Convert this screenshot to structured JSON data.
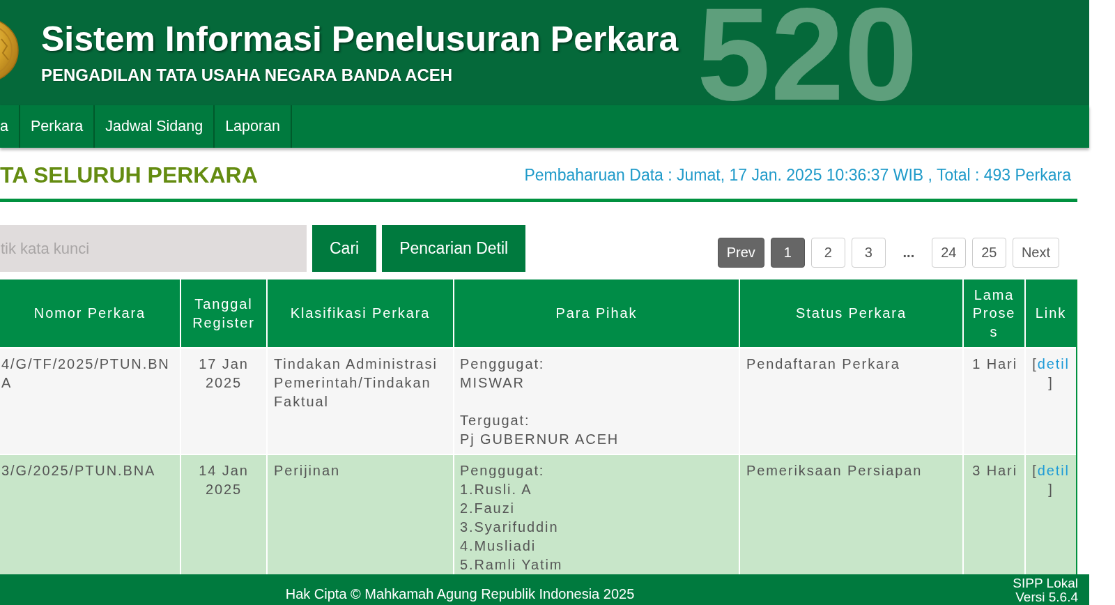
{
  "header": {
    "title": "Sistem Informasi Penelusuran Perkara",
    "subtitle": "PENGADILAN TATA USAHA NEGARA BANDA ACEH",
    "background_number": "520"
  },
  "nav": {
    "items": [
      {
        "label": "a"
      },
      {
        "label": "Perkara"
      },
      {
        "label": "Jadwal Sidang"
      },
      {
        "label": "Laporan"
      }
    ]
  },
  "page_heading": {
    "title": "TA SELURUH PERKARA",
    "update_info": "Pembaharuan Data : Jumat, 17 Jan. 2025 10:36:37 WIB , Total : 493 Perkara"
  },
  "search": {
    "placeholder": "tik kata kunci",
    "buttons": [
      {
        "label": "Cari"
      },
      {
        "label": "Pencarian Detil"
      }
    ]
  },
  "pagination": [
    {
      "kind": "prev",
      "label": "Prev",
      "disabled": true
    },
    {
      "kind": "page",
      "label": "1",
      "selected": true
    },
    {
      "kind": "page",
      "label": "2",
      "selected": false
    },
    {
      "kind": "page",
      "label": "3",
      "selected": false
    },
    {
      "kind": "ellipsis",
      "label": "..."
    },
    {
      "kind": "page",
      "label": "24",
      "selected": false
    },
    {
      "kind": "page",
      "label": "25",
      "selected": false
    },
    {
      "kind": "next",
      "label": "Next",
      "disabled": false
    }
  ],
  "table": {
    "columns": [
      "Nomor Perkara",
      "Tanggal Register",
      "Klasifikasi Perkara",
      "Para Pihak",
      "Status Perkara",
      "Lama Proses",
      "Link"
    ],
    "rows": [
      {
        "nomor_perkara": "4/G/TF/2025/PTUN.BNA",
        "tanggal_register": "17 Jan 2025",
        "klasifikasi_perkara": "Tindakan Administrasi Pemerintah/Tindakan Faktual",
        "para_pihak": [
          {
            "role": "Penggugat:",
            "names": [
              "MISWAR"
            ]
          },
          {
            "role": "Tergugat:",
            "names": [
              "Pj GUBERNUR ACEH"
            ]
          }
        ],
        "status_perkara": "Pendaftaran Perkara",
        "lama_proses": "1 Hari",
        "link": {
          "open": "[",
          "label": "detil",
          "close": "]"
        }
      },
      {
        "nomor_perkara": "3/G/2025/PTUN.BNA",
        "tanggal_register": "14 Jan 2025",
        "klasifikasi_perkara": "Perijinan",
        "para_pihak": [
          {
            "role": "Penggugat:",
            "names": [
              "1.Rusli. A",
              "2.Fauzi",
              "3.Syarifuddin",
              "4.Musliadi",
              "5.Ramli Yatim"
            ]
          }
        ],
        "status_perkara": "Pemeriksaan Persiapan",
        "lama_proses": "3 Hari",
        "link": {
          "open": "[",
          "label": "detil",
          "close": "]"
        }
      }
    ]
  },
  "footer": {
    "copyright": "Hak Cipta © Mahkamah Agung Republik Indonesia 2025",
    "app_name": "SIPP Lokal",
    "version": "Versi 5.6.4"
  }
}
